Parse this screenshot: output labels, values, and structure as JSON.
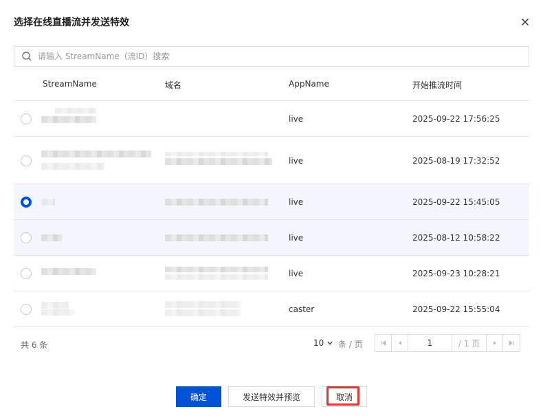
{
  "dialog": {
    "title": "选择在线直播流并发送特效",
    "close_icon": "close-icon"
  },
  "search": {
    "placeholder": "请输入 StreamName（流ID）搜索",
    "value": ""
  },
  "table": {
    "headers": {
      "stream_name": "StreamName",
      "domain": "域名",
      "app_name": "AppName",
      "start_time": "开始推流时间"
    },
    "rows": [
      {
        "selected": false,
        "app_name": "live",
        "start_time": "2025-09-22 17:56:25"
      },
      {
        "selected": false,
        "app_name": "live",
        "start_time": "2025-08-19 17:32:52"
      },
      {
        "selected": true,
        "app_name": "live",
        "start_time": "2025-09-22 15:45:05"
      },
      {
        "selected": false,
        "app_name": "live",
        "start_time": "2025-08-12 10:58:22"
      },
      {
        "selected": false,
        "app_name": "live",
        "start_time": "2025-09-23 10:28:21"
      },
      {
        "selected": false,
        "app_name": "caster",
        "start_time": "2025-09-22 15:55:04"
      }
    ]
  },
  "pagination": {
    "total_text": "共 6 条",
    "page_size": "10",
    "per_page_label": "条 / 页",
    "current_page": "1",
    "total_pages_text": "/ 1 页"
  },
  "buttons": {
    "confirm": "确定",
    "send_preview": "发送特效并预览",
    "cancel": "取消"
  },
  "colors": {
    "primary": "#0052d9",
    "selected_row": "#f3f6fc",
    "highlight_border": "#e0342e"
  }
}
